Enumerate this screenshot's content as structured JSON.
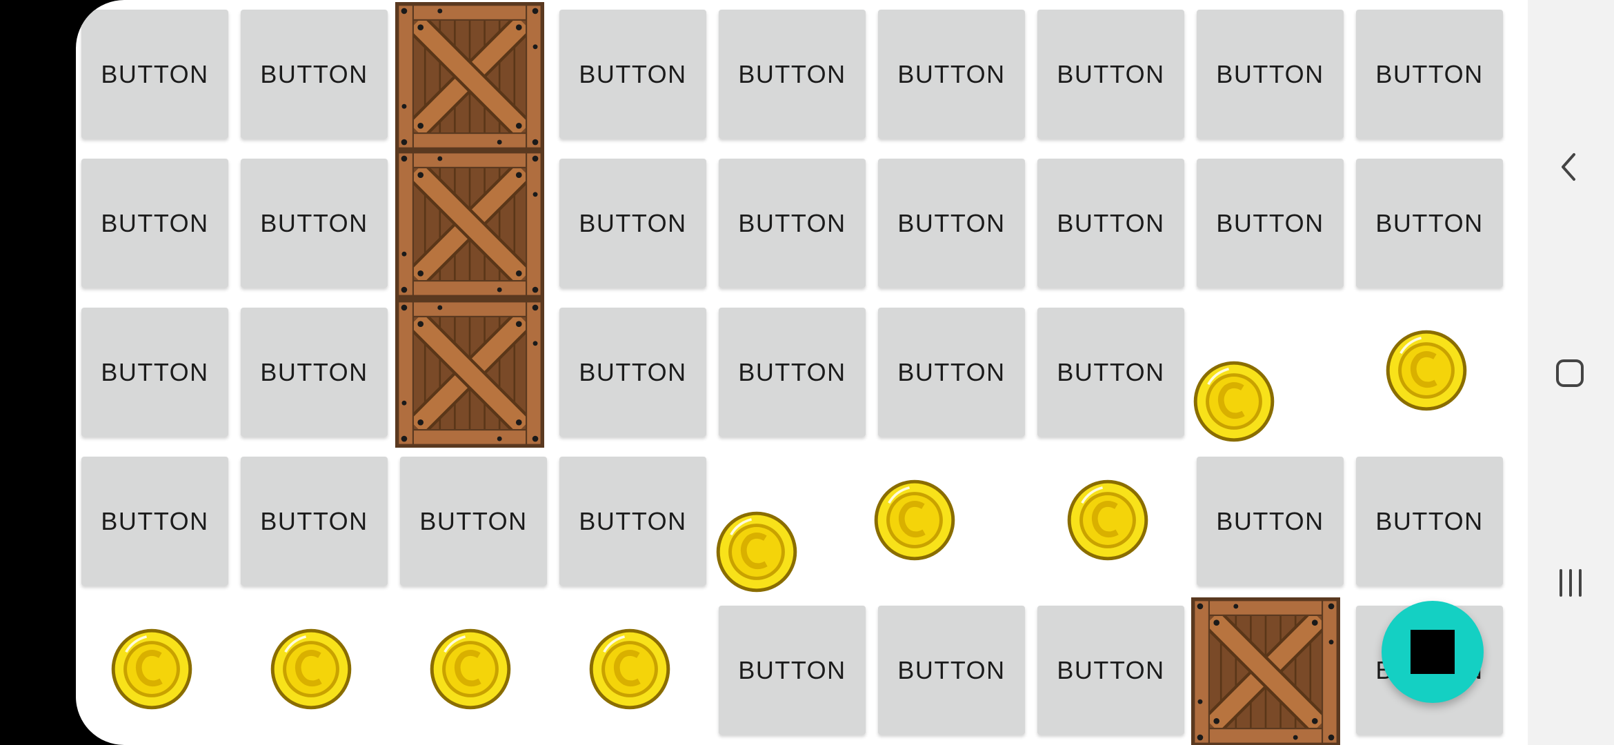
{
  "screen": {
    "button_label": "BUTTON",
    "grid": [
      [
        "button",
        "button",
        "crate",
        "button",
        "button",
        "button",
        "button",
        "button",
        "button"
      ],
      [
        "button",
        "button",
        "crate",
        "button",
        "button",
        "button",
        "button",
        "button",
        "button"
      ],
      [
        "button",
        "button",
        "crate",
        "button",
        "button",
        "button",
        "button",
        "coin",
        "coin"
      ],
      [
        "button",
        "button",
        "button",
        "button",
        "coin",
        "coin",
        "coin",
        "button",
        "button"
      ],
      [
        "coin",
        "coin",
        "coin",
        "coin",
        "button",
        "button",
        "button",
        "crate",
        "button"
      ]
    ]
  },
  "fab": {
    "icon": "stop-icon",
    "color": "#14d0c3"
  },
  "navigation_bar": {
    "back_icon": "back-chevron-icon",
    "home_icon": "home-square-icon",
    "recents_icon": "recents-lines-icon"
  },
  "colors": {
    "button_bg": "#d7d8d8",
    "crate_wood": "#a8683e",
    "coin_gold": "#f5d90a"
  }
}
